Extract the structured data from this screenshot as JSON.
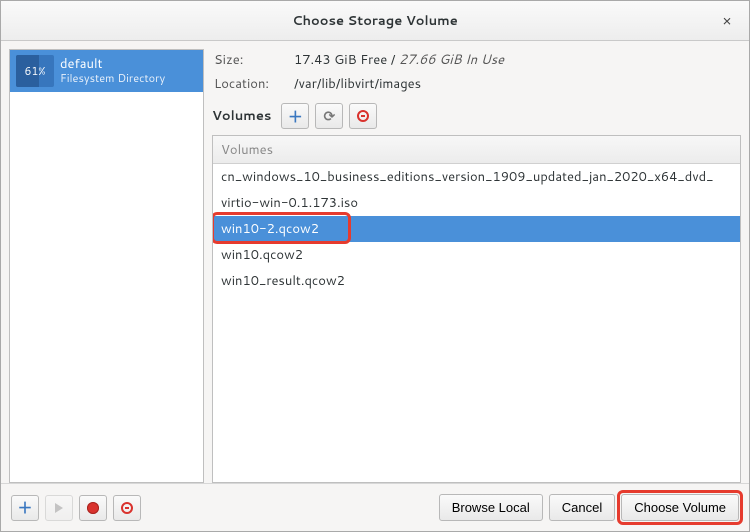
{
  "window": {
    "title": "Choose Storage Volume",
    "close_glyph": "×"
  },
  "sidebar": {
    "pools": [
      {
        "percent": "61%",
        "name": "default",
        "subtitle": "Filesystem Directory",
        "selected": true
      }
    ]
  },
  "details": {
    "size_label": "Size:",
    "size_free": "17.43 GiB Free",
    "size_sep": " / ",
    "size_inuse": "27.66 GiB In Use",
    "location_label": "Location:",
    "location_value": "/var/lib/libvirt/images"
  },
  "volumes": {
    "toolbar_label": "Volumes",
    "header": "Volumes",
    "list": [
      {
        "name": "cn_windows_10_business_editions_version_1909_updated_jan_2020_x64_dvd_",
        "selected": false
      },
      {
        "name": "virtio-win-0.1.173.iso",
        "selected": false
      },
      {
        "name": "win10-2.qcow2",
        "selected": true
      },
      {
        "name": "win10.qcow2",
        "selected": false
      },
      {
        "name": "win10_result.qcow2",
        "selected": false
      }
    ]
  },
  "footer": {
    "browse_local": "Browse Local",
    "cancel": "Cancel",
    "choose_volume": "Choose Volume"
  },
  "icons": {
    "add_pool": "plus-icon",
    "start_pool": "play-icon",
    "stop_pool": "stop-icon",
    "delete_pool": "minus-icon",
    "add_volume": "plus-icon",
    "refresh_volume": "refresh-icon",
    "delete_volume": "minus-icon"
  }
}
